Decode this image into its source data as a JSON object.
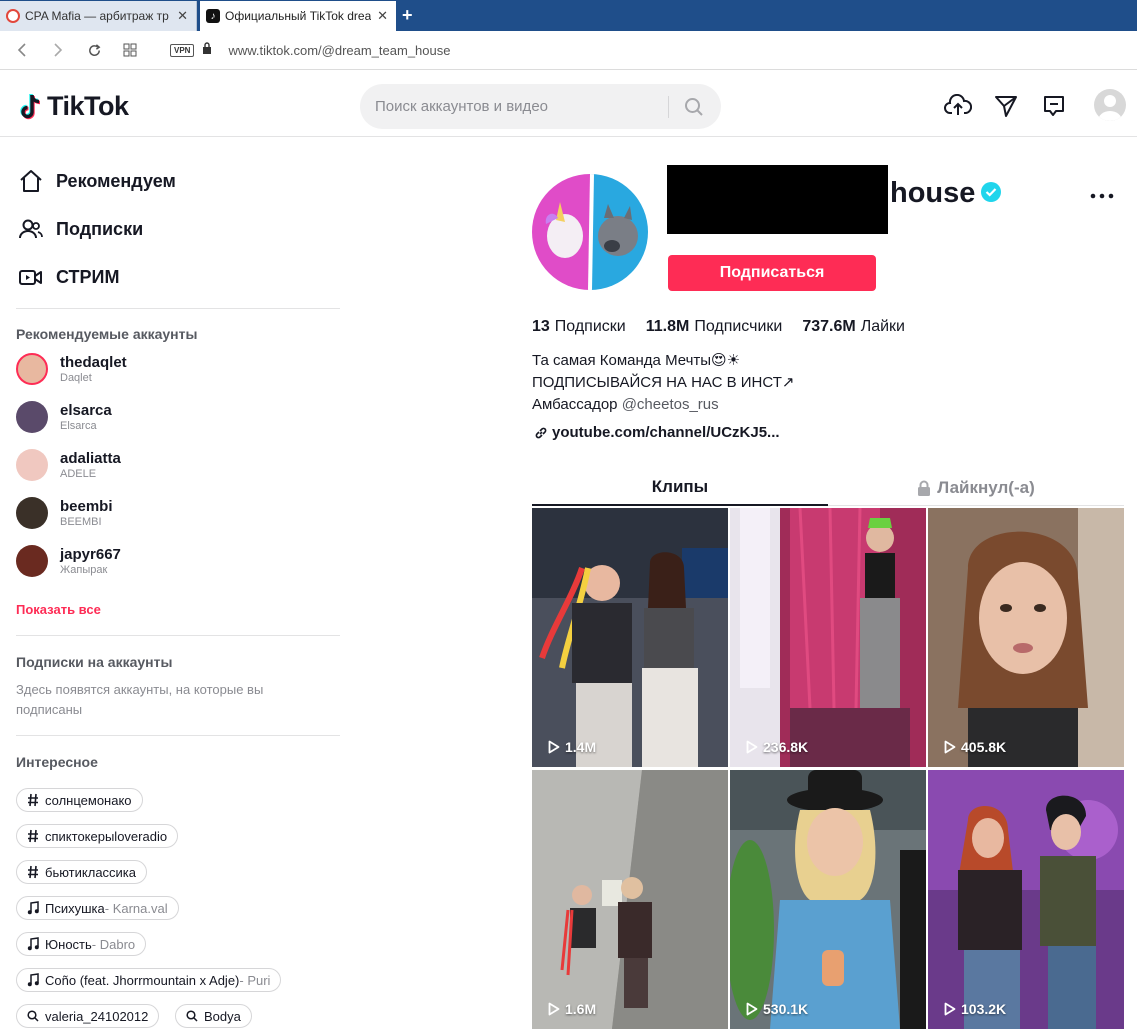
{
  "browser": {
    "tabs": [
      {
        "title": "CPA Mafia — арбитраж тр",
        "active": false
      },
      {
        "title": "Официальный TikTok drea",
        "active": true
      }
    ],
    "new_tab": "+",
    "close": "✕",
    "vpn_label": "VPN",
    "url": "www.tiktok.com/@dream_team_house"
  },
  "header": {
    "logo_text": "TikTok",
    "search_placeholder": "Поиск аккаунтов и видео"
  },
  "sidebar": {
    "nav": [
      {
        "label": "Рекомендуем",
        "icon": "home-icon"
      },
      {
        "label": "Подписки",
        "icon": "users-icon"
      },
      {
        "label": "СТРИМ",
        "icon": "live-icon"
      }
    ],
    "suggested_title": "Рекомендуемые аккаунты",
    "accounts": [
      {
        "username": "thedaqlet",
        "name": "Daqlet",
        "color": "#e8b8a0"
      },
      {
        "username": "elsarca",
        "name": "Elsarca",
        "color": "#5a4a6a"
      },
      {
        "username": "adaliatta",
        "name": "ADELE",
        "color": "#f0c8c0"
      },
      {
        "username": "beembi",
        "name": "BEEMBI",
        "color": "#3a3028"
      },
      {
        "username": "japyr667",
        "name": "Жапырак",
        "color": "#6a2a20"
      }
    ],
    "show_all": "Показать все",
    "following_title": "Подписки на аккаунты",
    "following_hint": "Здесь появятся аккаунты, на которые вы подписаны",
    "discover_title": "Интересное",
    "tags": [
      {
        "type": "hashtag",
        "text": "солнцемонако",
        "extra": ""
      },
      {
        "type": "hashtag",
        "text": "спиктокерыloveradio",
        "extra": ""
      },
      {
        "type": "hashtag",
        "text": "бьютиклассика",
        "extra": ""
      },
      {
        "type": "music",
        "text": "Психушка",
        "extra": " - Karna.val"
      },
      {
        "type": "music",
        "text": "Юность",
        "extra": " - Dabro"
      },
      {
        "type": "music",
        "text": "Coño (feat. Jhorrmountain x Adje)",
        "extra": " - Puri"
      },
      {
        "type": "search",
        "text": "valeria_24102012",
        "extra": ""
      },
      {
        "type": "search",
        "text": "Bodya",
        "extra": ""
      }
    ]
  },
  "profile": {
    "name_suffix": "house",
    "follow_label": "Подписаться",
    "stats": [
      {
        "value": "13",
        "label": "Подписки"
      },
      {
        "value": "11.8M",
        "label": "Подписчики"
      },
      {
        "value": "737.6M",
        "label": "Лайки"
      }
    ],
    "bio": [
      "Та самая Команда Мечты😍☀",
      "ПОДПИСЫВАЙСЯ НА НАС В ИНСТ↗"
    ],
    "bio_ambassador": "Амбассадор ",
    "bio_mention": "@cheetos_rus",
    "link": "youtube.com/channel/UCzKJ5...",
    "tabs": [
      {
        "label": "Клипы",
        "active": true
      },
      {
        "label": "Лайкнул(-а)",
        "active": false
      }
    ],
    "videos": [
      {
        "views": "1.4M",
        "bg": "#4a4f5c"
      },
      {
        "views": "236.8K",
        "bg": "#a02c58"
      },
      {
        "views": "405.8K",
        "bg": "#8a7260"
      },
      {
        "views": "1.6M",
        "bg": "#9a9a96"
      },
      {
        "views": "530.1K",
        "bg": "#6a7478"
      },
      {
        "views": "103.2K",
        "bg": "#6a3a8a"
      }
    ]
  },
  "colors": {
    "accent": "#fe2c55",
    "verified": "#20d5ec",
    "text": "#161823",
    "muted": "#8a8b91"
  }
}
